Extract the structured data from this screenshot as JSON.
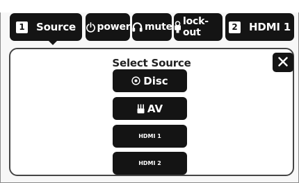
{
  "tabs": [
    {
      "number": "1",
      "label": "Source"
    },
    {
      "label": "power",
      "icon": "power-icon"
    },
    {
      "label": "mute",
      "icon": "headphones-icon"
    },
    {
      "label": "lock-out",
      "icon": "lock-icon"
    },
    {
      "number": "2",
      "label": "HDMI 1"
    }
  ],
  "panel": {
    "title": "Select Source",
    "close_icon": "close-icon",
    "sources": [
      {
        "label": "Disc",
        "icon": "disc-icon"
      },
      {
        "label": "AV",
        "icon": "av-connector-icon"
      },
      {
        "label": "HDMI 1"
      },
      {
        "label": "HDMI 2"
      }
    ]
  },
  "colors": {
    "button": "#141414",
    "button_text": "#ffffff",
    "background": "#ffffff"
  }
}
